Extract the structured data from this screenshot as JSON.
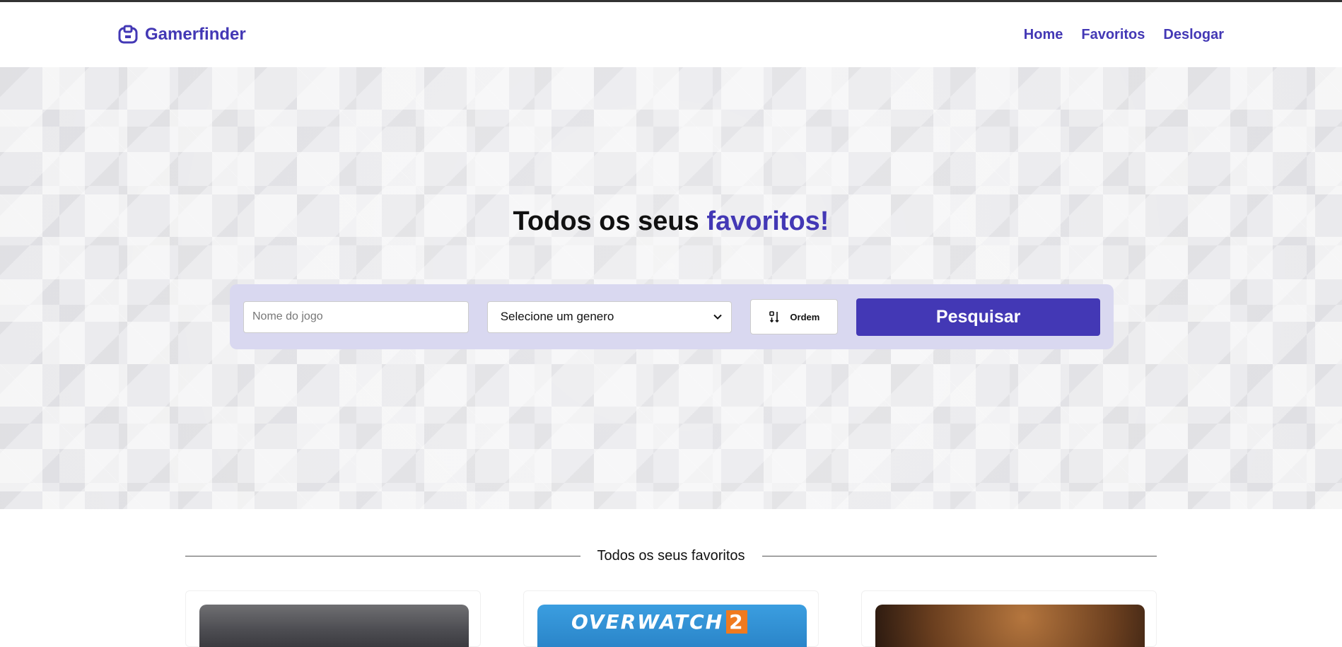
{
  "header": {
    "brand": "Gamerfinder",
    "nav": [
      {
        "label": "Home"
      },
      {
        "label": "Favoritos"
      },
      {
        "label": "Deslogar"
      }
    ]
  },
  "hero": {
    "title_prefix": "Todos os seus ",
    "title_accent": "favoritos!",
    "search": {
      "name_placeholder": "Nome do jogo",
      "name_value": "",
      "genre_selected": "Selecione um genero",
      "order_label": "Ordem",
      "submit_label": "Pesquisar"
    }
  },
  "favorites": {
    "section_title": "Todos os seus favoritos",
    "cards": [
      {
        "logo_text": ""
      },
      {
        "logo_text": "OVERWATCH",
        "logo_number": "2"
      },
      {
        "logo_text": ""
      }
    ]
  },
  "colors": {
    "accent": "#4338b5",
    "panel": "#d9d8f0"
  },
  "icons": {
    "brand": "gamepad-logo-icon",
    "select_chevron": "chevron-down-icon",
    "order": "sort-icon"
  }
}
